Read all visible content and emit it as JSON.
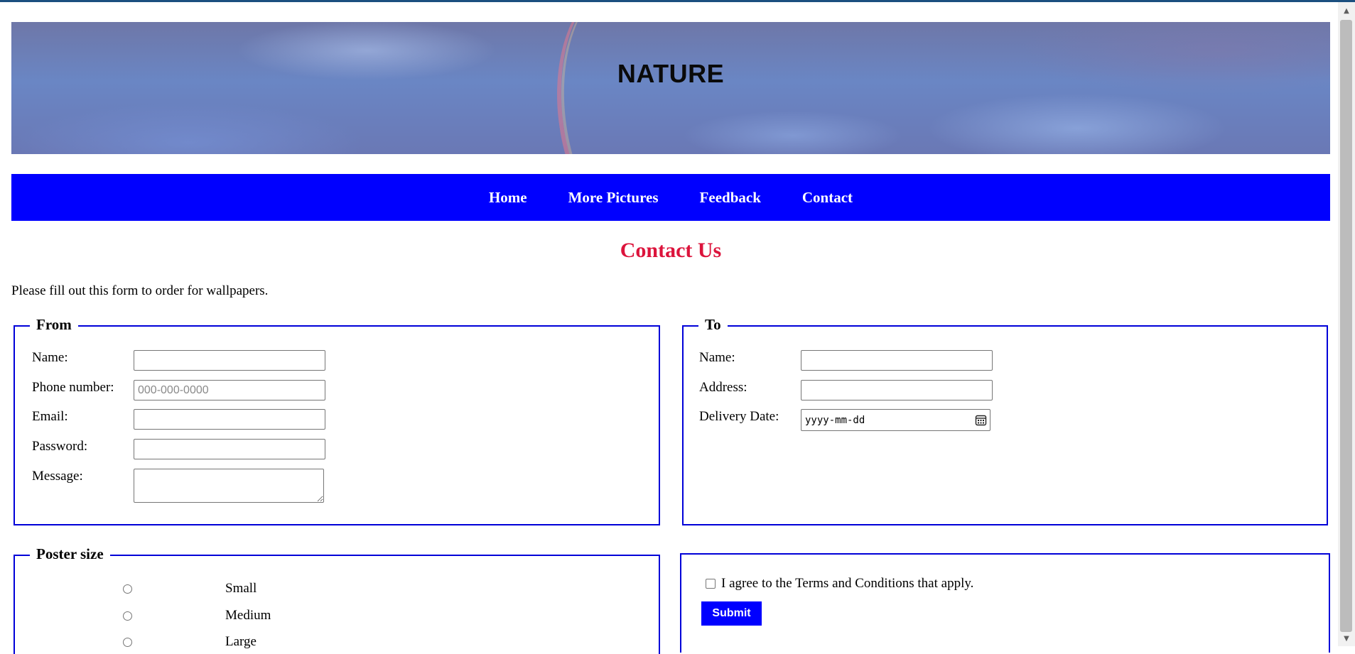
{
  "banner": {
    "title": "NATURE"
  },
  "nav": {
    "items": [
      {
        "label": "Home"
      },
      {
        "label": "More Pictures"
      },
      {
        "label": "Feedback"
      },
      {
        "label": "Contact"
      }
    ]
  },
  "page": {
    "heading": "Contact Us",
    "intro": "Please fill out this form to order for wallpapers."
  },
  "from_section": {
    "legend": "From",
    "name_label": "Name:",
    "phone_label": "Phone number:",
    "phone_placeholder": "000-000-0000",
    "email_label": "Email:",
    "password_label": "Password:",
    "message_label": "Message:"
  },
  "to_section": {
    "legend": "To",
    "name_label": "Name:",
    "address_label": "Address:",
    "delivery_label": "Delivery Date:",
    "date_placeholder": "yyyy-mm-dd"
  },
  "poster_section": {
    "legend": "Poster size",
    "options": [
      {
        "label": "Small"
      },
      {
        "label": "Medium"
      },
      {
        "label": "Large"
      }
    ]
  },
  "agreement": {
    "terms_label": "I agree to the Terms and Conditions that apply.",
    "submit_label": "Submit"
  },
  "icons": {
    "calendar": "calendar-icon"
  },
  "colors": {
    "nav_bg": "#0000ff",
    "heading": "#dc143c",
    "fieldset_border": "#0000d8"
  }
}
